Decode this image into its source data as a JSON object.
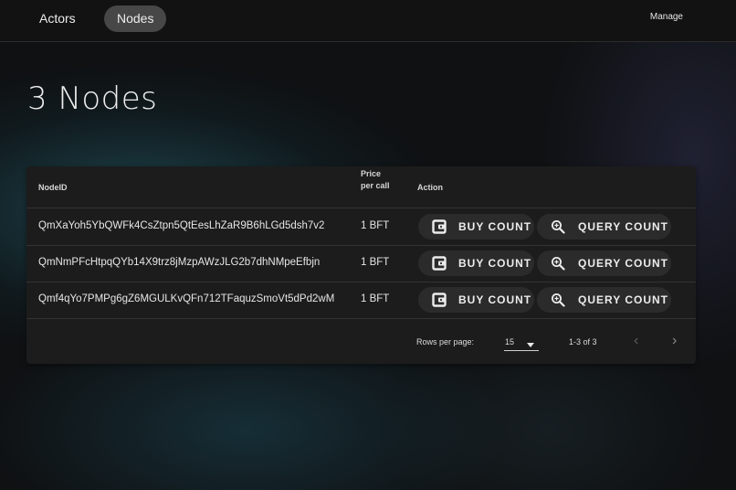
{
  "nav": {
    "tabs": [
      {
        "label": "Actors",
        "active": false
      },
      {
        "label": "Nodes",
        "active": true
      }
    ],
    "manage_label": "Manage"
  },
  "page": {
    "title": "3 Nodes"
  },
  "table": {
    "headers": {
      "node_id": "NodeID",
      "price_line1": "Price",
      "price_line2": "per call",
      "action": "Action"
    },
    "rows": [
      {
        "node_id": "QmXaYoh5YbQWFk4CsZtpn5QtEesLhZaR9B6hLGd5dsh7v2",
        "price": "1 BFT",
        "buy_label": "BUY COUNT",
        "query_label": "QUERY COUNT"
      },
      {
        "node_id": "QmNmPFcHtpqQYb14X9trz8jMzpAWzJLG2b7dhNMpeEfbjn",
        "price": "1 BFT",
        "buy_label": "BUY COUNT",
        "query_label": "QUERY COUNT"
      },
      {
        "node_id": "Qmf4qYo7PMPg6gZ6MGULKvQFn712TFaquzSmoVt5dPd2wM",
        "price": "1 BFT",
        "buy_label": "BUY COUNT",
        "query_label": "QUERY COUNT"
      }
    ],
    "icons": {
      "buy": "wallet-icon",
      "query": "zoom-search-icon"
    },
    "footer": {
      "rows_per_page_label": "Rows per page:",
      "rows_per_page_value": "15",
      "range": "1-3 of 3",
      "prev": "‹",
      "next": "›"
    }
  },
  "colors": {
    "background": "#0f1113",
    "topbar": "#121212",
    "active_tab": "#474747",
    "card": "#1c1c1c",
    "button": "#2b2b2b",
    "glow": "#286e7d"
  }
}
